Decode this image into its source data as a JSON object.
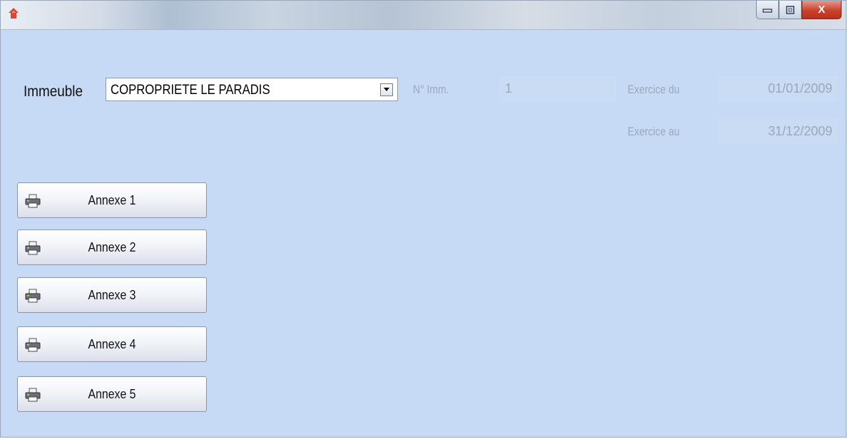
{
  "window": {
    "title": "",
    "controls": {
      "minimize": "minimize",
      "maximize": "maximize",
      "close": "X"
    }
  },
  "form": {
    "immeuble_label": "Immeuble",
    "immeuble_value": "COPROPRIETE LE PARADIS",
    "num_label": "N° Imm.",
    "num_value": "1",
    "exercice_du_label": "Exercice du",
    "exercice_du_value": "01/01/2009",
    "exercice_au_label": "Exercice au",
    "exercice_au_value": "31/12/2009"
  },
  "buttons": [
    {
      "label": "Annexe 1",
      "icon": "printer-icon"
    },
    {
      "label": "Annexe 2",
      "icon": "printer-icon"
    },
    {
      "label": "Annexe 3",
      "icon": "printer-icon"
    },
    {
      "label": "Annexe 4",
      "icon": "printer-icon"
    },
    {
      "label": "Annexe 5",
      "icon": "printer-icon"
    }
  ],
  "colors": {
    "background": "#c6daf5",
    "close_button": "#c9422b"
  }
}
